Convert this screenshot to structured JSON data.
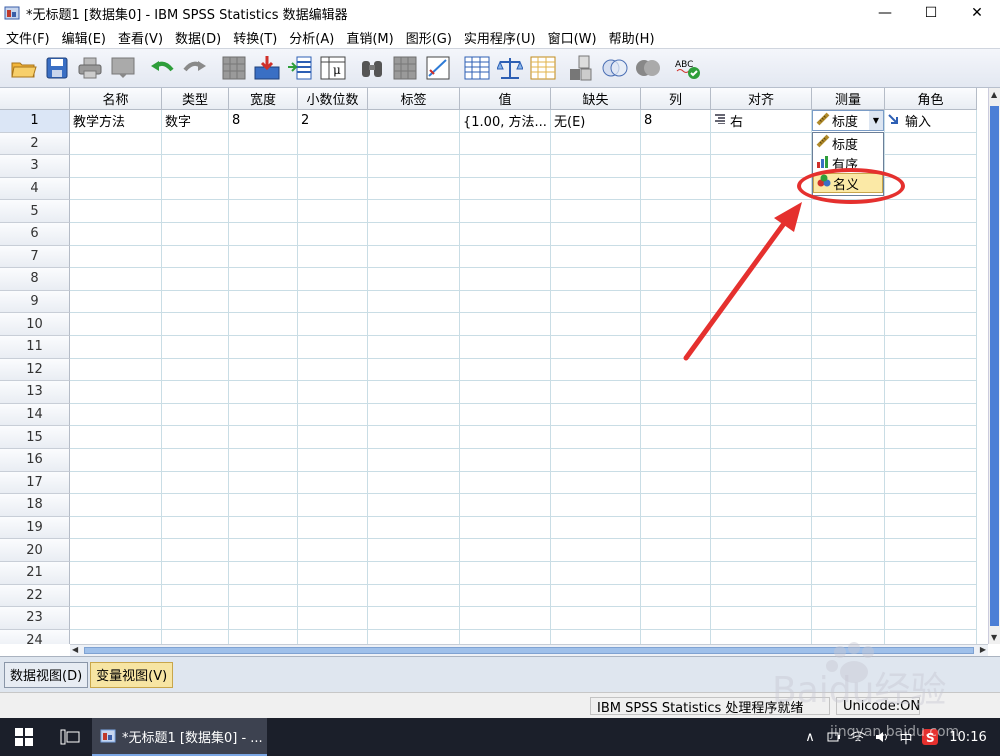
{
  "window": {
    "title": "*无标题1 [数据集0] - IBM SPSS Statistics 数据编辑器",
    "minimize": "—",
    "maximize": "☐",
    "close": "✕"
  },
  "menu": [
    "文件(F)",
    "编辑(E)",
    "查看(V)",
    "数据(D)",
    "转换(T)",
    "分析(A)",
    "直销(M)",
    "图形(G)",
    "实用程序(U)",
    "窗口(W)",
    "帮助(H)"
  ],
  "toolbar_icons": [
    "open-icon",
    "save-icon",
    "print-icon",
    "dialog-recall-icon",
    "undo-icon",
    "redo-icon",
    "goto-case-icon",
    "goto-variable-icon",
    "variables-icon",
    "value-labels-icon",
    "find-icon",
    "insert-cases-icon",
    "insert-variable-icon",
    "split-file-icon",
    "weight-cases-icon",
    "select-cases-icon",
    "value-labels-toggle-icon",
    "use-sets-icon",
    "show-sets-icon",
    "spell-check-icon"
  ],
  "grid": {
    "columns": [
      "名称",
      "类型",
      "宽度",
      "小数位数",
      "标签",
      "值",
      "缺失",
      "列",
      "对齐",
      "测量",
      "角色"
    ],
    "row_numbers": [
      "1",
      "2",
      "3",
      "4",
      "5",
      "6",
      "7",
      "8",
      "9",
      "10",
      "11",
      "12",
      "13",
      "14",
      "15",
      "16",
      "17",
      "18",
      "19",
      "20",
      "21",
      "22",
      "23",
      "24"
    ],
    "row1": {
      "name": "教学方法",
      "type": "数字",
      "width": "8",
      "decimals": "2",
      "label": "",
      "values": "{1.00, 方法...",
      "missing": "无(E)",
      "columns": "8",
      "align": "右",
      "measure": "标度",
      "role": "输入"
    }
  },
  "measure_dropdown": {
    "selected": "标度",
    "options": [
      "标度",
      "有序",
      "名义"
    ],
    "highlighted": "名义"
  },
  "view_tabs": {
    "data_view": "数据视图(D)",
    "variable_view": "变量视图(V)"
  },
  "status": {
    "processor": "IBM SPSS Statistics 处理程序就绪",
    "unicode": "Unicode:ON"
  },
  "taskbar": {
    "app_label": "*无标题1 [数据集0] - ...",
    "ime": "中",
    "clock": "10:16",
    "tray_up": "∧"
  },
  "watermark": {
    "brand": "Baidu经验",
    "url": "jingyan.baidu.com"
  },
  "colors": {
    "accent_red": "#e5302e",
    "active_tab": "#f7e5a3",
    "scroll_thumb": "#4c7fd6"
  }
}
